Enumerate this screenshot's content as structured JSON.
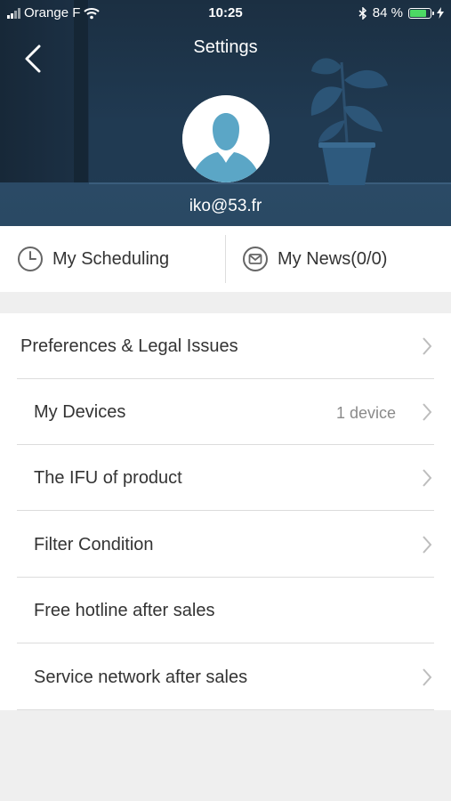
{
  "status_bar": {
    "carrier": "Orange F",
    "time": "10:25",
    "battery_percent": "84 %",
    "battery_level": 0.84
  },
  "header": {
    "title": "Settings",
    "email": "iko@53.fr"
  },
  "quick_links": [
    {
      "label": "My Scheduling",
      "icon": "clock-icon"
    },
    {
      "label": "My News(0/0)",
      "icon": "envelope-icon"
    }
  ],
  "menu": [
    {
      "label": "Preferences & Legal Issues",
      "value": "",
      "chevron": true
    },
    {
      "label": "My Devices",
      "value": "1 device",
      "chevron": true
    },
    {
      "label": "The IFU of product",
      "value": "",
      "chevron": true
    },
    {
      "label": "Filter Condition",
      "value": "",
      "chevron": true
    },
    {
      "label": "Free hotline after sales",
      "value": "",
      "chevron": false
    },
    {
      "label": "Service network after sales",
      "value": "",
      "chevron": true
    }
  ],
  "colors": {
    "header_bg": "#1f3b53",
    "avatar_blue": "#5ba6c6",
    "battery_green": "#4cd964",
    "page_bg": "#efefef"
  }
}
